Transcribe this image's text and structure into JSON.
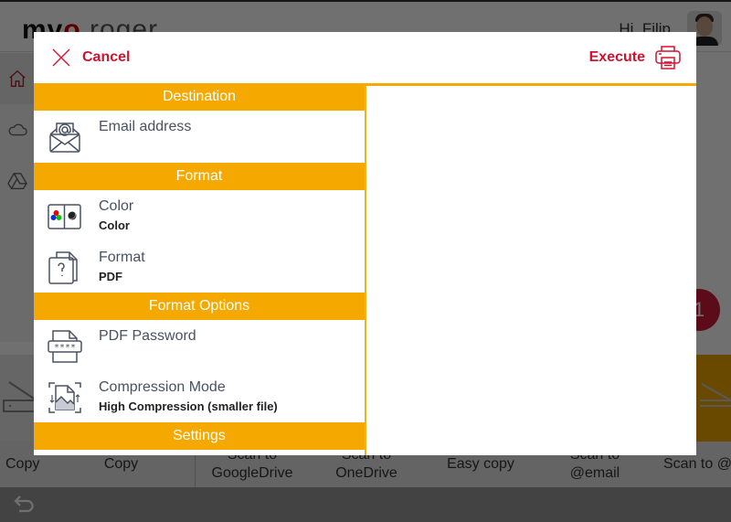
{
  "background": {
    "logo": {
      "part1": "mv",
      "part2": "o",
      "part3": " roger"
    },
    "greeting": "Hi, Filip",
    "fab_label": "1",
    "tiles": [
      {
        "label": "Copy"
      },
      {
        "label": "Copy"
      },
      {
        "label": "Scan to GoogleDrive"
      },
      {
        "label": "Scan to OneDrive"
      },
      {
        "label": "Easy copy"
      },
      {
        "label": "Scan to @email"
      },
      {
        "label": "Scan to @"
      }
    ],
    "back_icon": "undo-arrow-icon"
  },
  "modal": {
    "cancel_label": "Cancel",
    "execute_label": "Execute",
    "sections": [
      {
        "header": "Destination",
        "items": [
          {
            "icon": "envelope-at-icon",
            "title": "Email address",
            "value": ""
          }
        ]
      },
      {
        "header": "Format",
        "items": [
          {
            "icon": "color-mode-icon",
            "title": "Color",
            "value": "Color"
          },
          {
            "icon": "file-format-icon",
            "title": "Format",
            "value": "PDF"
          }
        ]
      },
      {
        "header": "Format Options",
        "items": [
          {
            "icon": "pdf-password-icon",
            "title": "PDF Password",
            "value": ""
          },
          {
            "icon": "compression-icon",
            "title": "Compression Mode",
            "value": "High Compression (smaller file)"
          }
        ]
      },
      {
        "header": "Settings",
        "items": []
      }
    ]
  },
  "colors": {
    "accent_red": "#d4122e",
    "section_orange": "#f5a800",
    "icon_gray": "#4a5260"
  }
}
